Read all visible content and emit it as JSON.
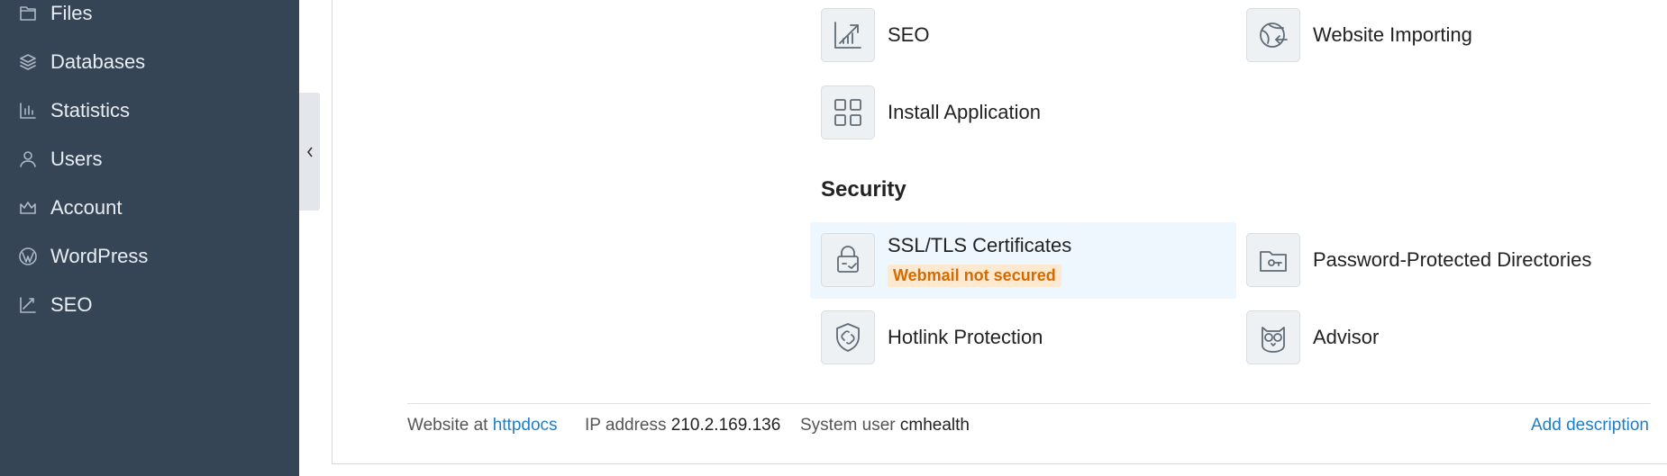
{
  "sidebar": {
    "items": [
      {
        "label": "Files",
        "icon": "folder-icon"
      },
      {
        "label": "Databases",
        "icon": "database-icon"
      },
      {
        "label": "Statistics",
        "icon": "statistics-icon"
      },
      {
        "label": "Users",
        "icon": "user-icon"
      },
      {
        "label": "Account",
        "icon": "crown-icon"
      },
      {
        "label": "WordPress",
        "icon": "wordpress-icon"
      },
      {
        "label": "SEO",
        "icon": "seo-icon"
      }
    ]
  },
  "tools": {
    "seo": "SEO",
    "website_importing": "Website Importing",
    "install_application": "Install Application"
  },
  "security": {
    "title": "Security",
    "ssl": "SSL/TLS Certificates",
    "ssl_badge": "Webmail not secured",
    "password_dirs": "Password-Protected Directories",
    "hotlink": "Hotlink Protection",
    "advisor": "Advisor"
  },
  "footer": {
    "website_at_label": "Website at",
    "website_at_link": "httpdocs",
    "ip_label": "IP address",
    "ip_value": "210.2.169.136",
    "sysuser_label": "System user",
    "sysuser_value": "cmhealth",
    "add_description": "Add description"
  },
  "colors": {
    "sidebar_bg": "#364556",
    "link": "#1e7ec8",
    "badge_bg": "#fde9cf",
    "badge_text": "#d66a00",
    "highlight_bg": "#eef7fd"
  }
}
